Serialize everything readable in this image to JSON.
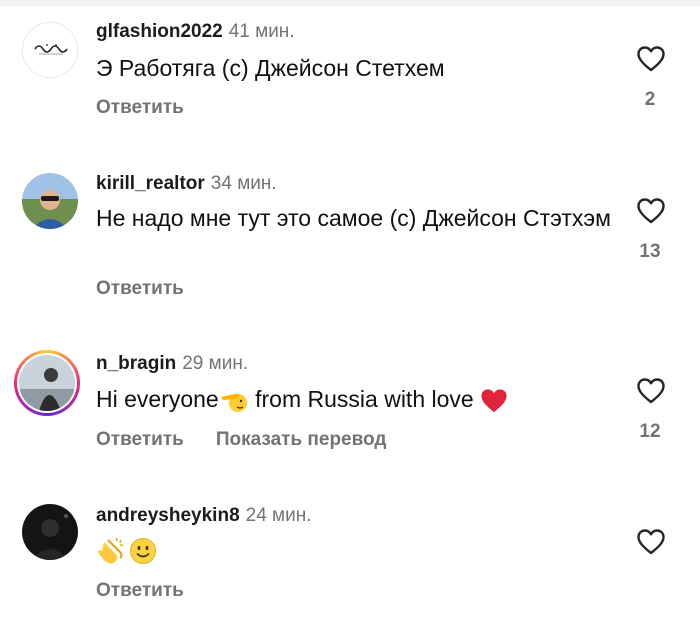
{
  "comments": [
    {
      "username": "glfashion2022",
      "time": "41 мин.",
      "text": "Э Работяга (с) Джейсон Стетхем",
      "reply_label": "Ответить",
      "likes": "2",
      "avatar": "logo-avatar"
    },
    {
      "username": "kirill_realtor",
      "time": "34 мин.",
      "text": "Не надо мне тут это самое (с) Джейсон Стэтхэм",
      "reply_label": "Ответить",
      "likes": "13",
      "avatar": "photo-avatar"
    },
    {
      "username": "n_bragin",
      "time": "29 мин.",
      "text_part1": "Hi everyone",
      "text_part2": " from Russia with love ",
      "reply_label": "Ответить",
      "translate_label": "Показать перевод",
      "likes": "12",
      "avatar": "photo-avatar-story-ring"
    },
    {
      "username": "andreysheykin8",
      "time": "24 мин.",
      "reply_label": "Ответить",
      "avatar": "dark-photo-avatar"
    }
  ],
  "colors": {
    "username": "#1c1c1c",
    "secondary": "#737373",
    "heart_red": "#e0243a"
  },
  "icons": {
    "like": "heart-outline-icon",
    "salute": "saluting-face-emoji",
    "heart": "red-heart-emoji",
    "clap": "clapping-hands-emoji",
    "smile": "slightly-smiling-face-emoji"
  }
}
